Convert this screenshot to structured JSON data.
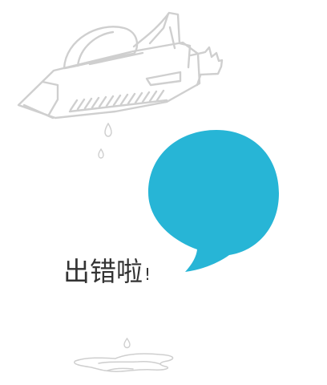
{
  "error": {
    "title": "出错啦",
    "mark": "!"
  },
  "colors": {
    "bubble": "#27b5d6",
    "outline": "#cfcfcf",
    "text": "#333333"
  },
  "icons": {
    "rocket": "sketched-rocket-icon",
    "bubble": "speech-bubble-icon",
    "drops": "water-drop-icon",
    "puddle": "puddle-icon"
  }
}
